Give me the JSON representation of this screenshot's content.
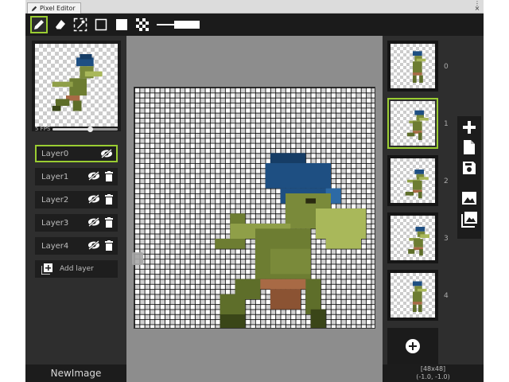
{
  "window": {
    "title": "Pixel Editor"
  },
  "toolbar": {
    "tools": [
      "pencil-tool",
      "eraser-tool",
      "color-picker-tool",
      "outline-color-swatch",
      "fill-color-swatch",
      "transparent-swatch",
      "brush-size-slider"
    ],
    "active_tool": "pencil-tool"
  },
  "preview": {
    "fps_label": "5 FPS",
    "fps_value": 5
  },
  "layers": [
    {
      "label": "Layer0"
    },
    {
      "label": "Layer1"
    },
    {
      "label": "Layer2"
    },
    {
      "label": "Layer3"
    },
    {
      "label": "Layer4"
    }
  ],
  "selected_layer": "Layer0",
  "add_layer_label": "Add layer",
  "image_name": "NewImage",
  "frames": [
    {
      "number": "0"
    },
    {
      "number": "1"
    },
    {
      "number": "2"
    },
    {
      "number": "3"
    },
    {
      "number": "4"
    }
  ],
  "selected_frame": "1",
  "status": {
    "size": "[48x48]",
    "coords": "(-1.0, -1.0)"
  },
  "colors": {
    "accent": "#9acd32",
    "panel": "#2e2e2e",
    "canvas_area": "#8d8d8d",
    "goblin_skin": "#7a8a3a",
    "goblin_hair": "#1e4f82",
    "goblin_cloth": "#a86a45"
  }
}
